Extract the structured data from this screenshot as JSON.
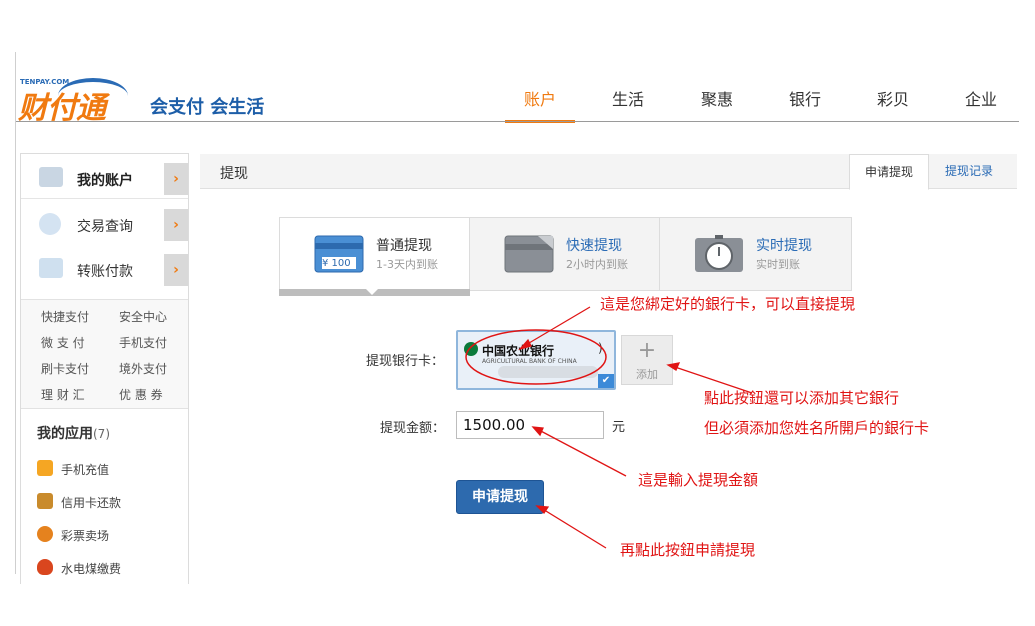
{
  "logo": {
    "brand_small": "TENPAY.COM",
    "brand": "财付通",
    "slogan": "会支付 会生活"
  },
  "topnav": [
    {
      "label": "账户",
      "active": true
    },
    {
      "label": "生活",
      "active": false
    },
    {
      "label": "聚惠",
      "active": false
    },
    {
      "label": "银行",
      "active": false
    },
    {
      "label": "彩贝",
      "active": false
    },
    {
      "label": "企业",
      "active": false
    }
  ],
  "sidebar": {
    "main": [
      {
        "label": "我的账户",
        "icon": "account-icon",
        "active": true
      },
      {
        "label": "交易查询",
        "icon": "magnifier-icon",
        "active": false
      },
      {
        "label": "转账付款",
        "icon": "transfer-icon",
        "active": false
      }
    ],
    "arrow": "›",
    "quick_links": [
      "快捷支付",
      "安全中心",
      "微 支 付",
      "手机支付",
      "刷卡支付",
      "境外支付",
      "理 财 汇",
      "优 惠 券"
    ],
    "apps_title": "我的应用",
    "apps_count": "(7)",
    "apps": [
      {
        "label": "手机充值",
        "icon": "phone-recharge-icon",
        "color": "#f5a623"
      },
      {
        "label": "信用卡还款",
        "icon": "credit-card-icon",
        "color": "#c98b2c"
      },
      {
        "label": "彩票卖场",
        "icon": "lottery-icon",
        "color": "#e5821e"
      },
      {
        "label": "水电煤缴费",
        "icon": "utility-flame-icon",
        "color": "#d9461e"
      }
    ]
  },
  "main": {
    "title": "提现",
    "tabs": [
      {
        "label": "申请提现",
        "active": true
      },
      {
        "label": "提现记录",
        "active": false
      }
    ],
    "types": [
      {
        "name": "普通提现",
        "sub": "1-3天内到账",
        "icon": "card-100-icon",
        "badge": "¥ 100",
        "active": true
      },
      {
        "name": "快速提现",
        "sub": "2小时内到账",
        "icon": "fast-card-icon",
        "active": false
      },
      {
        "name": "实时提现",
        "sub": "实时到账",
        "icon": "stopwatch-icon",
        "active": false
      }
    ],
    "form": {
      "card_label": "提现银行卡：",
      "bank_name": "中国农业银行",
      "bank_sub": "AGRICULTURAL BANK OF CHINA",
      "bank_paren": ")",
      "add_plus": "+",
      "add_label": "添加",
      "amount_label": "提现金额：",
      "amount_value": "1500.00",
      "unit": "元",
      "submit_label": "申请提现"
    }
  },
  "annotations": {
    "color": "#e01414",
    "note1": "這是您綁定好的銀行卡，可以直接提現",
    "note2a": "點此按鈕還可以添加其它銀行",
    "note2b": "但必須添加您姓名所開戶的銀行卡",
    "note3": "這是輸入提現金額",
    "note4": "再點此按鈕申請提現"
  }
}
